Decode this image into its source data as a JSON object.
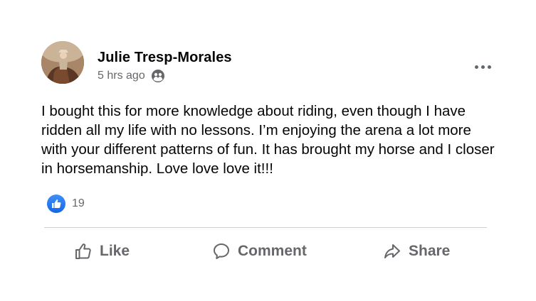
{
  "post": {
    "author": "Julie Tresp-Morales",
    "timestamp": "5 hrs ago",
    "audience_icon": "friends-globe-icon",
    "more_icon": "more-options-icon",
    "text": "I bought this for more knowledge about riding, even though I have ridden all my life with no lessons. I’m enjoying the arena a lot more with your different patterns of fun. It has brought my horse and I closer in horsemanship. Love love love it!!!",
    "reactions": {
      "icon": "like-reaction-icon",
      "count": "19"
    }
  },
  "actions": {
    "like_label": "Like",
    "comment_label": "Comment",
    "share_label": "Share"
  },
  "colors": {
    "text_primary": "#050505",
    "text_secondary": "#65676b",
    "like_blue": "#1877f2",
    "divider": "#ced0d4"
  }
}
